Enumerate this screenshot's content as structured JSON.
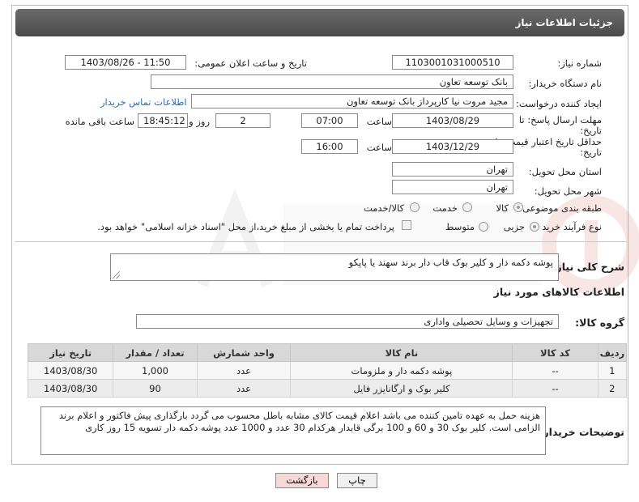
{
  "page": {
    "title": "جزئیات اطلاعات نیاز"
  },
  "form": {
    "need_number": {
      "label": "شماره نیاز:",
      "value": "1103001031000510"
    },
    "announce_datetime": {
      "label": "تاریخ و ساعت اعلان عمومی:",
      "value": "1403/08/26 - 11:50"
    },
    "buyer_org": {
      "label": "نام دستگاه خریدار:",
      "value": "بانک توسعه تعاون"
    },
    "requester": {
      "label": "ایجاد کننده درخواست:",
      "value": "مجید مروت نیا کارپرداز بانک توسعه تعاون",
      "contact_link": "اطلاعات تماس خریدار"
    },
    "response_deadline": {
      "label_line1": "مهلت ارسال پاسخ: تا",
      "label_line2": "تاریخ:",
      "date": "1403/08/29",
      "time_label": "ساعت",
      "time": "07:00",
      "days": "2",
      "days_label": "روز و",
      "remaining": "18:45:12",
      "remaining_label": "ساعت باقی مانده"
    },
    "price_validity": {
      "label_line1": "حداقل تاریخ اعتبار قیمت: تا",
      "label_line2": "تاریخ:",
      "date": "1403/12/29",
      "time_label": "ساعت",
      "time": "16:00"
    },
    "delivery_province": {
      "label": "استان محل تحویل:",
      "value": "تهران"
    },
    "delivery_city": {
      "label": "شهر محل تحویل:",
      "value": "تهران"
    },
    "category": {
      "label": "طبقه بندی موضوعی:",
      "options": [
        "کالا",
        "خدمت",
        "کالا/خدمت"
      ],
      "selected": "کالا"
    },
    "purchase_process": {
      "label": "نوع فرآیند خرید :",
      "options": [
        "جزیی",
        "متوسط"
      ],
      "selected": "جزیی",
      "payment_note": "پرداخت تمام یا بخشی از مبلغ خرید،از محل \"اسناد خزانه اسلامی\" خواهد بود."
    },
    "need_description": {
      "label": "شرح کلی نیاز:",
      "value": "پوشه دکمه دار و کلیر بوک قاب دار برند سهند یا پاپکو"
    },
    "goods_info_heading": "اطلاعات کالاهای مورد نیاز",
    "goods_group": {
      "label": "گروه کالا:",
      "value": "تجهیزات و وسایل تحصیلی واداری"
    },
    "table": {
      "headers": [
        "ردیف",
        "کد کالا",
        "نام کالا",
        "واحد شمارش",
        "تعداد / مقدار",
        "تاریخ نیاز"
      ],
      "rows": [
        [
          "1",
          "--",
          "پوشه دکمه دار و ملزومات",
          "عدد",
          "1,000",
          "1403/08/30"
        ],
        [
          "2",
          "--",
          "کلیر بوک و ارگانایزر فایل",
          "عدد",
          "90",
          "1403/08/30"
        ]
      ]
    },
    "buyer_notes": {
      "label": "توضیحات خریدار:",
      "value": "هزینه حمل به عهده تامین کننده می باشد اعلام قیمت کالای مشابه باطل محسوب می گردد بارگذاری پیش فاکتور و اعلام برند الزامی است. کلیر بوک 30 و 60 و 100 برگی قابدار هرکدام 30 عدد و 1000 عدد پوشه دکمه دار تسویه 15 روز کاری"
    }
  },
  "buttons": {
    "print": "چاپ",
    "back": "بازگشت"
  },
  "colors": {
    "title_bar": "#555555",
    "link": "#2a6db5",
    "back_button_bg": "#f7d7d7"
  }
}
